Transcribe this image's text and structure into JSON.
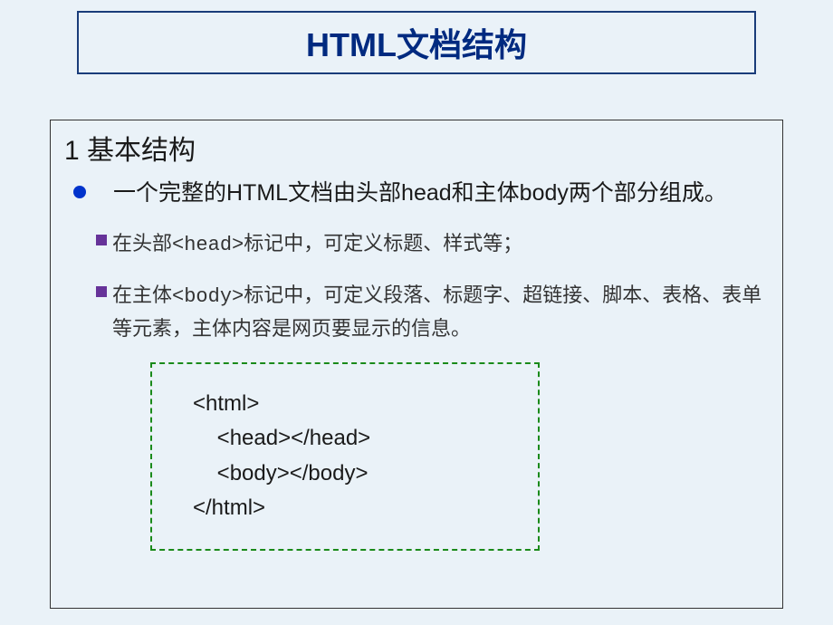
{
  "title": "HTML文档结构",
  "section": {
    "heading": "1 基本结构",
    "mainBullet": "一个完整的HTML文档由头部head和主体body两个部分组成。",
    "subBullets": [
      {
        "prefix": "在头部",
        "tag": "<head>",
        "suffix": "标记中，可定义标题、样式等；"
      },
      {
        "prefix": "在主体",
        "tag": "<body>",
        "suffix": "标记中，可定义段落、标题字、超链接、脚本、表格、表单等元素，主体内容是网页要显示的信息。"
      }
    ],
    "codeLines": [
      "<html>",
      "    <head></head>",
      "    <body></body>",
      "</html>"
    ]
  }
}
